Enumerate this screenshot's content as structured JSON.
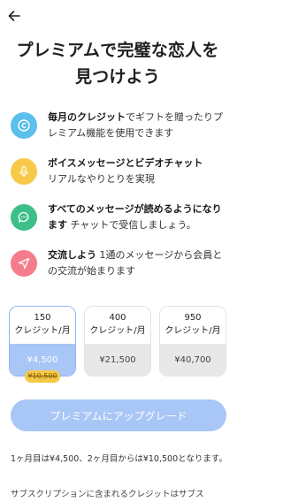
{
  "header": {
    "back_icon": "arrow-left-icon"
  },
  "title": "プレミアムで完璧な恋人を見つけよう",
  "features": [
    {
      "icon": "coin-icon",
      "color": "#5bc0eb",
      "bold": "毎月のクレジット",
      "text": "でギフトを贈ったりプレミアム機能を使用できます"
    },
    {
      "icon": "microphone-icon",
      "color": "#f7c948",
      "bold": "ボイスメッセージとビデオチャット",
      "text": "リアルなやりとりを実現"
    },
    {
      "icon": "chat-icon",
      "color": "#3dbf8a",
      "bold": "すべてのメッセージが読めるようになります",
      "text": " チャットで受信しましょう。"
    },
    {
      "icon": "send-icon",
      "color": "#f47c8c",
      "bold": "交流しよう",
      "text": " 1通のメッセージから会員との交流が始まります"
    }
  ],
  "plans": [
    {
      "credits": "150",
      "unit": "クレジット/月",
      "price": "¥4,500",
      "selected": true
    },
    {
      "credits": "400",
      "unit": "クレジット/月",
      "price": "¥21,500",
      "selected": false
    },
    {
      "credits": "950",
      "unit": "クレジット/月",
      "price": "¥40,700",
      "selected": false
    }
  ],
  "old_price": "¥10,500",
  "upgrade_button": "プレミアムにアップグレード",
  "price_note": "1ヶ月目は¥4,500、2ヶ月目からは¥10,500となります。",
  "subscription_note": "サブスクリプションに含まれるクレジットはサブス"
}
